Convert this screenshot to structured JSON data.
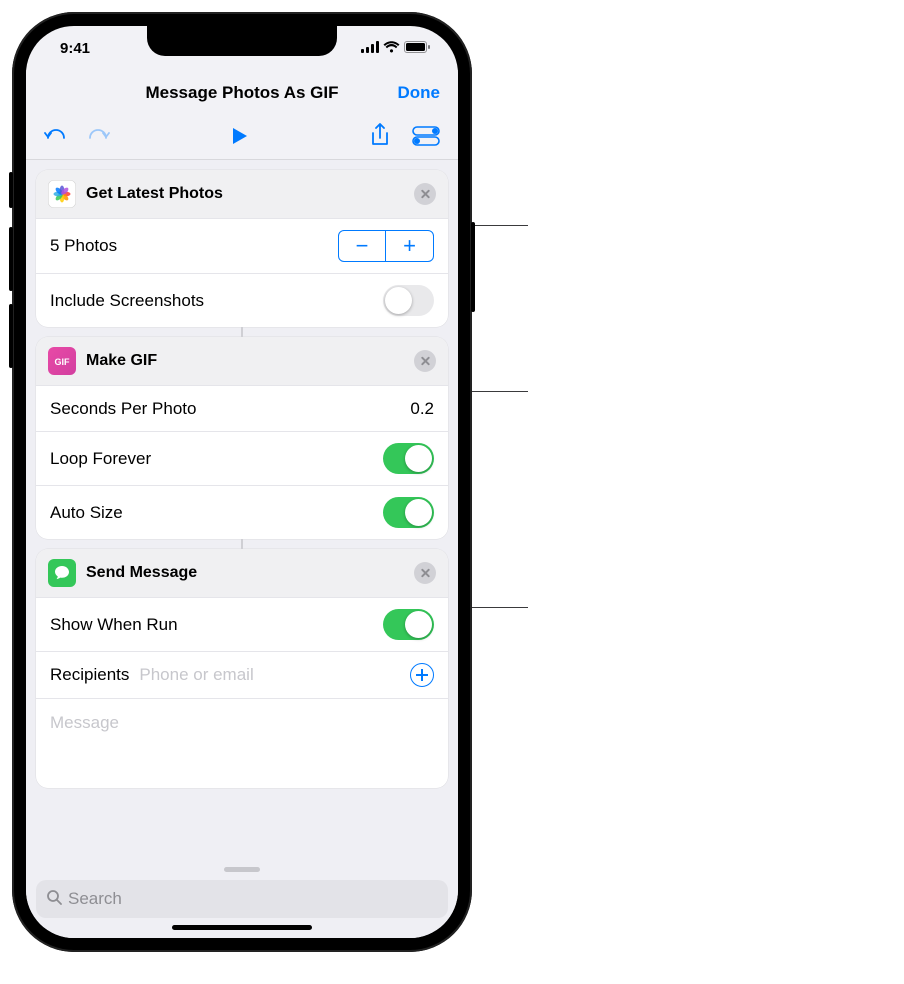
{
  "status": {
    "time": "9:41"
  },
  "nav": {
    "title": "Message Photos As GIF",
    "done": "Done"
  },
  "actions": {
    "getPhotos": {
      "title": "Get Latest Photos",
      "countLabel": "5 Photos",
      "includeScreenshotsLabel": "Include Screenshots",
      "includeScreenshotsOn": false
    },
    "makeGif": {
      "title": "Make GIF",
      "secondsLabel": "Seconds Per Photo",
      "secondsValue": "0.2",
      "loopLabel": "Loop Forever",
      "loopOn": true,
      "autoSizeLabel": "Auto Size",
      "autoSizeOn": true
    },
    "sendMessage": {
      "title": "Send Message",
      "showWhenRunLabel": "Show When Run",
      "showWhenRunOn": true,
      "recipientsLabel": "Recipients",
      "recipientsPlaceholder": "Phone or email",
      "messagePlaceholder": "Message"
    }
  },
  "search": {
    "placeholder": "Search"
  }
}
